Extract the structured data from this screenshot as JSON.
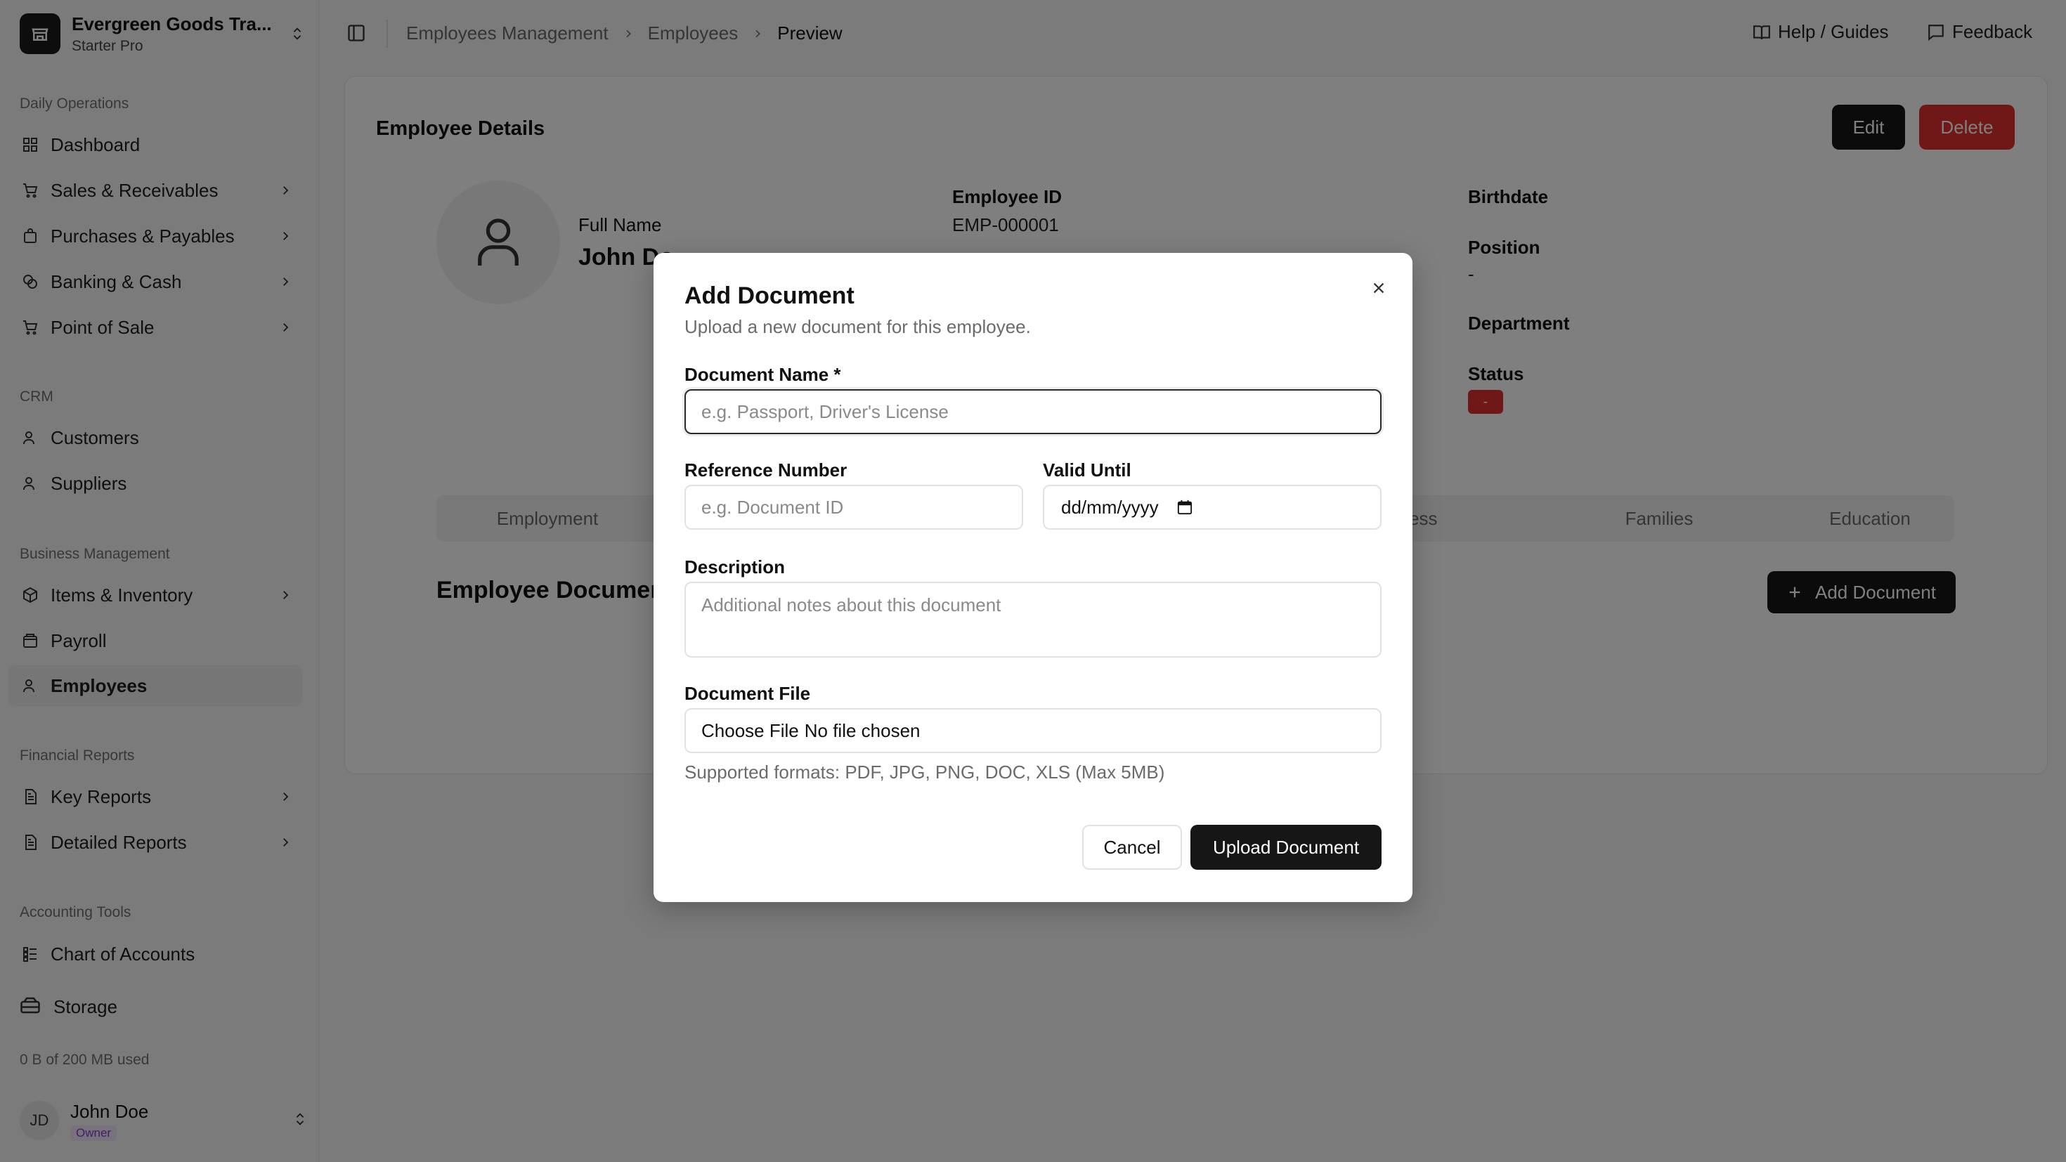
{
  "org": {
    "name": "Evergreen Goods Tra...",
    "plan": "Starter Pro"
  },
  "sidebar": {
    "sections": [
      {
        "label": "Daily Operations"
      },
      {
        "label": "CRM"
      },
      {
        "label": "Business Management"
      },
      {
        "label": "Financial Reports"
      },
      {
        "label": "Accounting Tools"
      }
    ],
    "items": [
      {
        "label": "Dashboard",
        "icon": "dashboard-icon"
      },
      {
        "label": "Sales & Receivables",
        "icon": "cart-icon"
      },
      {
        "label": "Purchases & Payables",
        "icon": "bag-icon"
      },
      {
        "label": "Banking & Cash",
        "icon": "coins-icon"
      },
      {
        "label": "Point of Sale",
        "icon": "cart-icon"
      },
      {
        "label": "Customers",
        "icon": "user-icon"
      },
      {
        "label": "Suppliers",
        "icon": "user-icon"
      },
      {
        "label": "Items & Inventory",
        "icon": "package-icon"
      },
      {
        "label": "Payroll",
        "icon": "wallet-icon"
      },
      {
        "label": "Employees",
        "icon": "user-icon",
        "active": true
      },
      {
        "label": "Key Reports",
        "icon": "report-icon"
      },
      {
        "label": "Detailed Reports",
        "icon": "report-icon"
      },
      {
        "label": "Chart of Accounts",
        "icon": "list-icon"
      }
    ],
    "storage": {
      "label": "Storage",
      "used": "0 B of 200 MB used"
    },
    "user": {
      "initials": "JD",
      "name": "John Doe",
      "role": "Owner"
    }
  },
  "topbar": {
    "breadcrumb": [
      "Employees Management",
      "Employees",
      "Preview"
    ],
    "help": "Help / Guides",
    "feedback": "Feedback"
  },
  "employee": {
    "title": "Employee Details",
    "edit": "Edit",
    "delete": "Delete",
    "full_name_label": "Full Name",
    "full_name": "John Do",
    "employee_id_label": "Employee ID",
    "employee_id": "EMP-000001",
    "birthdate_label": "Birthdate",
    "position_label": "Position",
    "position": "-",
    "department_label": "Department",
    "status_label": "Status",
    "status": "-",
    "tabs": [
      "Employment",
      "ress",
      "Families",
      "Education"
    ],
    "docs_title": "Employee Documents",
    "add_document": "Add Document"
  },
  "modal": {
    "title": "Add Document",
    "description": "Upload a new document for this employee.",
    "doc_name_label": "Document Name *",
    "doc_name_placeholder": "e.g. Passport, Driver's License",
    "ref_label": "Reference Number",
    "ref_placeholder": "e.g. Document ID",
    "valid_label": "Valid Until",
    "valid_value": "dd/mm/yyyy",
    "desc_label": "Description",
    "desc_placeholder": "Additional notes about this document",
    "file_label": "Document File",
    "file_button": "Choose File",
    "file_status": "No file chosen",
    "file_help": "Supported formats: PDF, JPG, PNG, DOC, XLS (Max 5MB)",
    "cancel": "Cancel",
    "upload": "Upload Document"
  },
  "colors": {
    "accent": "#161616",
    "danger": "#e03131",
    "role_badge": "#8a3bc8"
  }
}
